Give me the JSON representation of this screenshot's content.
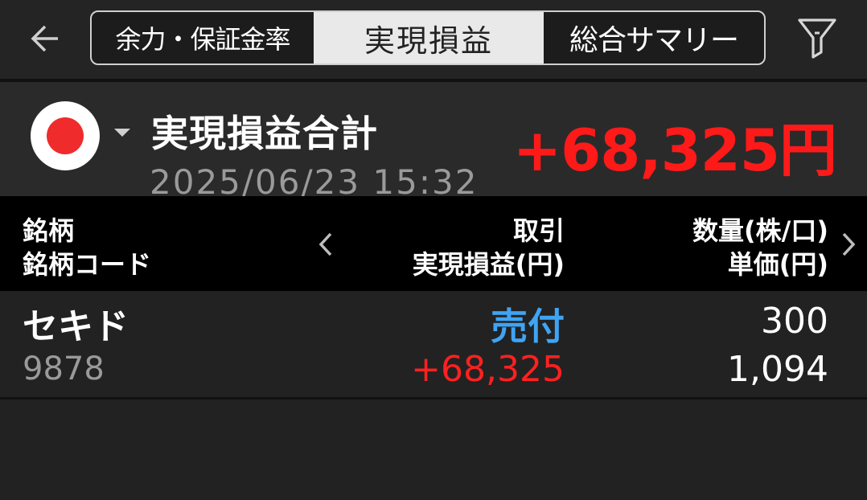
{
  "nav": {
    "back_icon": "arrow-left-icon",
    "filter_icon": "filter-funnel-icon"
  },
  "tabs": [
    {
      "label": "余力・保証金率",
      "selected": false
    },
    {
      "label": "実現損益",
      "selected": true
    },
    {
      "label": "総合サマリー",
      "selected": false
    }
  ],
  "summary": {
    "market_icon": "japan-flag-icon",
    "title": "実現損益合計",
    "total": "+68,325円",
    "datetime": "2025/06/23 15:32"
  },
  "table": {
    "headers": {
      "col1_line1": "銘柄",
      "col1_line2": "銘柄コード",
      "col2_line1": "取引",
      "col2_line2": "実現損益(円)",
      "col3_line1": "数量(株/口)",
      "col3_line2": "単価(円)"
    },
    "rows": [
      {
        "name": "セキド",
        "code": "9878",
        "trade": "売付",
        "pl": "+68,325",
        "qty": "300",
        "price": "1,094"
      }
    ]
  },
  "colors": {
    "background": "#222222",
    "profit_red": "#ff1a1a",
    "sell_blue": "#3fa4f4",
    "header_bg": "#000000"
  }
}
